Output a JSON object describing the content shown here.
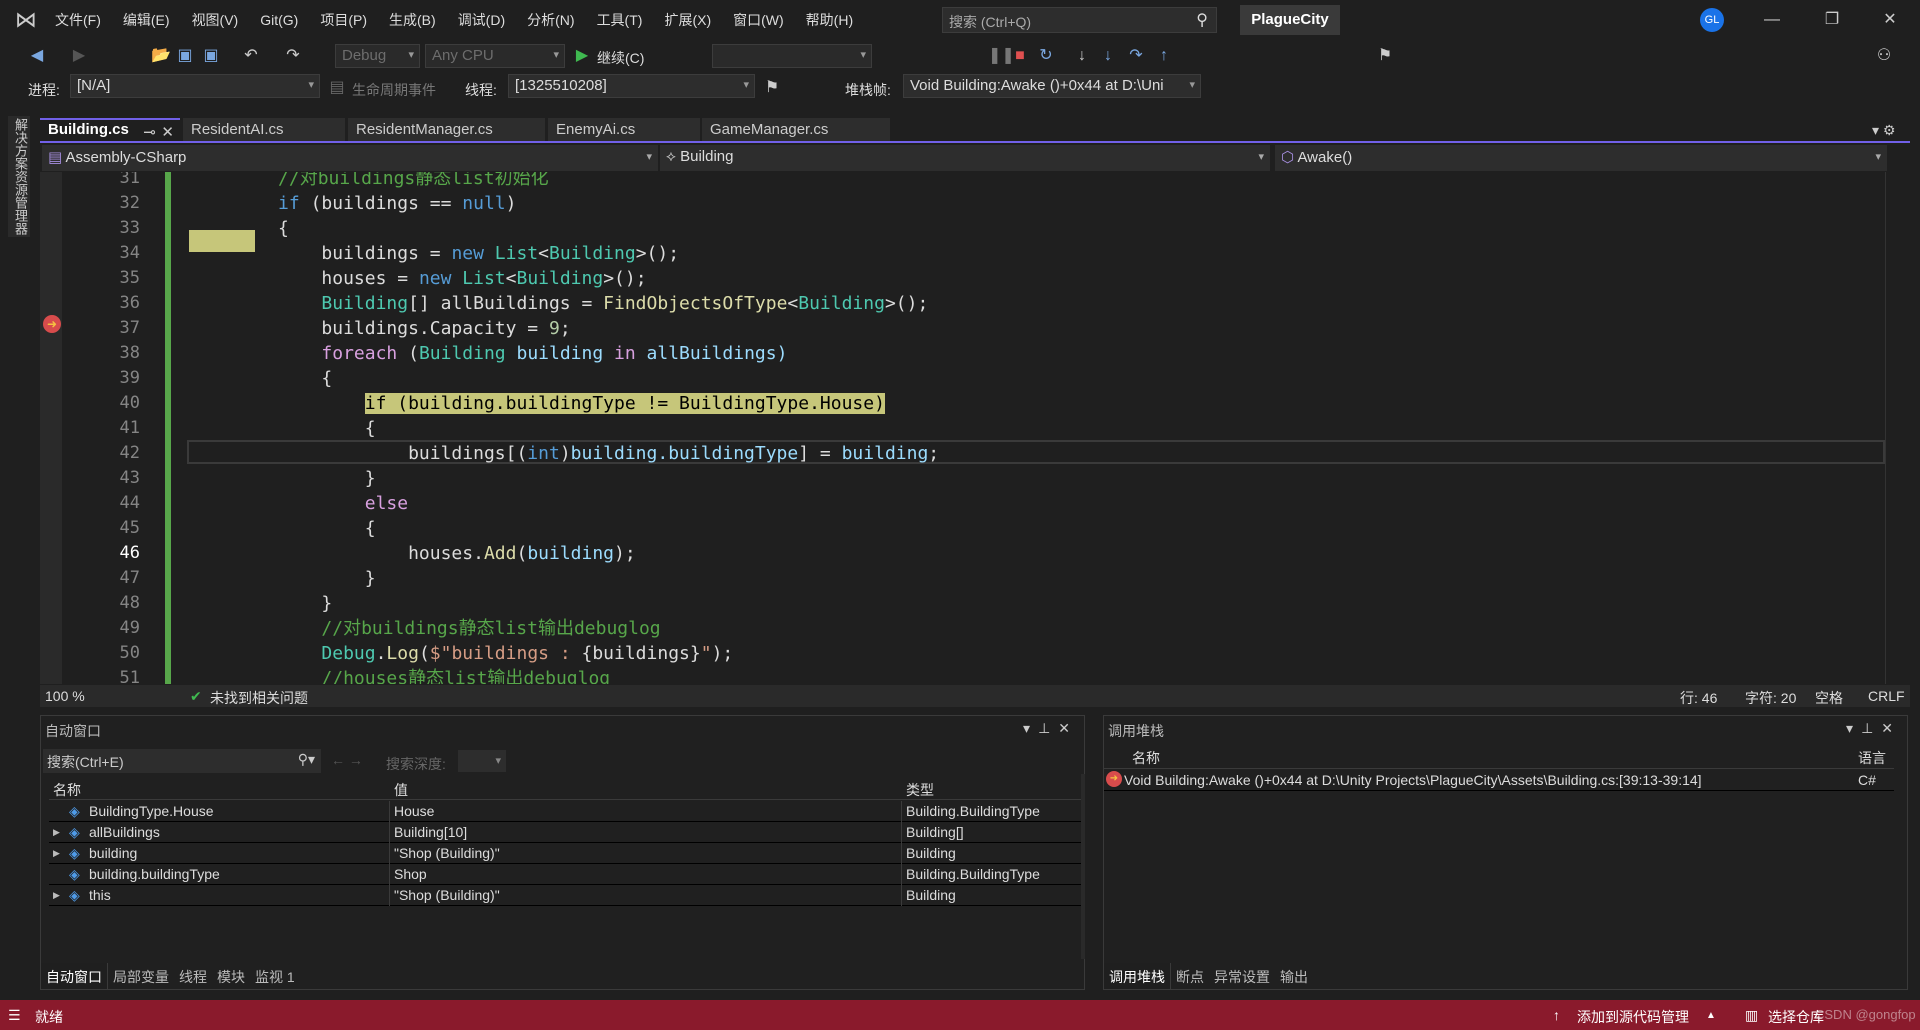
{
  "menubar": {
    "items": [
      "文件(F)",
      "编辑(E)",
      "视图(V)",
      "Git(G)",
      "项目(P)",
      "生成(B)",
      "调试(D)",
      "分析(N)",
      "工具(T)",
      "扩展(X)",
      "窗口(W)",
      "帮助(H)"
    ],
    "search_placeholder": "搜索 (Ctrl+Q)",
    "project": "PlagueCity",
    "avatar": "GL"
  },
  "toolbar": {
    "config": "Debug",
    "platform": "Any CPU",
    "continue": "继续(C)"
  },
  "debugbar": {
    "process_label": "进程:",
    "process": "[N/A]",
    "lifecycle": "生命周期事件",
    "thread_label": "线程:",
    "thread": "[1325510208]",
    "stackframe_label": "堆栈帧:",
    "stackframe": "Void Building:Awake ()+0x44 at D:\\Uni"
  },
  "sidebar": {
    "solution_explorer": "解决方案资源管理器"
  },
  "tabs": [
    {
      "label": "Building.cs",
      "active": true
    },
    {
      "label": "ResidentAI.cs"
    },
    {
      "label": "ResidentManager.cs"
    },
    {
      "label": "EnemyAi.cs"
    },
    {
      "label": "GameManager.cs"
    }
  ],
  "navbar": {
    "project": "Assembly-CSharp",
    "class": "Building",
    "member": "Awake()"
  },
  "code": {
    "current_line": 46,
    "next_statement_line": 40,
    "lines": [
      {
        "n": 31,
        "t": [
          [
            "            //对buildings静态list初始化",
            "cm"
          ]
        ]
      },
      {
        "n": 32,
        "t": [
          [
            "            ",
            "p"
          ],
          [
            "if",
            "k"
          ],
          [
            " (buildings == ",
            "p"
          ],
          [
            "null",
            "k"
          ],
          [
            ")",
            "p"
          ]
        ]
      },
      {
        "n": 33,
        "t": [
          [
            "            {",
            "p"
          ]
        ]
      },
      {
        "n": 34,
        "t": [
          [
            "                buildings = ",
            "p"
          ],
          [
            "new",
            "k"
          ],
          [
            " ",
            "p"
          ],
          [
            "List",
            "t"
          ],
          [
            "<",
            "p"
          ],
          [
            "Building",
            "t"
          ],
          [
            ">();",
            "p"
          ]
        ]
      },
      {
        "n": 35,
        "t": [
          [
            "                houses = ",
            "p"
          ],
          [
            "new",
            "k"
          ],
          [
            " ",
            "p"
          ],
          [
            "List",
            "t"
          ],
          [
            "<",
            "p"
          ],
          [
            "Building",
            "t"
          ],
          [
            ">();",
            "p"
          ]
        ]
      },
      {
        "n": 36,
        "t": [
          [
            "                ",
            "p"
          ],
          [
            "Building",
            "t"
          ],
          [
            "[] allBuildings = ",
            "p"
          ],
          [
            "FindObjectsOfType",
            "m"
          ],
          [
            "<",
            "p"
          ],
          [
            "Building",
            "t"
          ],
          [
            ">();",
            "p"
          ]
        ]
      },
      {
        "n": 37,
        "t": [
          [
            "                buildings.Capacity = ",
            "p"
          ],
          [
            "9",
            "n"
          ],
          [
            ";",
            "p"
          ]
        ]
      },
      {
        "n": 38,
        "t": [
          [
            "                ",
            "p"
          ],
          [
            "foreach",
            "c"
          ],
          [
            " (",
            "p"
          ],
          [
            "Building",
            "t"
          ],
          [
            " building ",
            "v"
          ],
          [
            "in",
            "c"
          ],
          [
            " allBuildings)",
            "v"
          ]
        ]
      },
      {
        "n": 39,
        "t": [
          [
            "                {",
            "p"
          ]
        ]
      },
      {
        "n": 40,
        "hl": "if (building.buildingType != BuildingType.House)",
        "t": [
          [
            "                    ",
            "p"
          ]
        ]
      },
      {
        "n": 41,
        "t": [
          [
            "                    {",
            "p"
          ]
        ]
      },
      {
        "n": 42,
        "t": [
          [
            "                        buildings[(",
            "p"
          ],
          [
            "int",
            "k"
          ],
          [
            ")",
            "p"
          ],
          [
            "building.buildingType",
            "v"
          ],
          [
            "] = ",
            "p"
          ],
          [
            "building",
            "v"
          ],
          [
            ";",
            "p"
          ]
        ]
      },
      {
        "n": 43,
        "t": [
          [
            "                    }",
            "p"
          ]
        ]
      },
      {
        "n": 44,
        "t": [
          [
            "                    ",
            "p"
          ],
          [
            "else",
            "c"
          ]
        ]
      },
      {
        "n": 45,
        "t": [
          [
            "                    {",
            "p"
          ]
        ]
      },
      {
        "n": 46,
        "t": [
          [
            "                        houses.",
            "p"
          ],
          [
            "Add",
            "m"
          ],
          [
            "(",
            "p"
          ],
          [
            "building",
            "v"
          ],
          [
            ");",
            "p"
          ]
        ]
      },
      {
        "n": 47,
        "t": [
          [
            "                    }",
            "p"
          ]
        ]
      },
      {
        "n": 48,
        "t": [
          [
            "                }",
            "p"
          ]
        ]
      },
      {
        "n": 49,
        "t": [
          [
            "                //对buildings静态list输出debuglog",
            "cm"
          ]
        ]
      },
      {
        "n": 50,
        "t": [
          [
            "                ",
            "p"
          ],
          [
            "Debug",
            "t"
          ],
          [
            ".",
            "p"
          ],
          [
            "Log",
            "m"
          ],
          [
            "(",
            "p"
          ],
          [
            "$\"buildings : ",
            "s"
          ],
          [
            "{buildings}",
            "p"
          ],
          [
            "\"",
            "s"
          ],
          [
            ");",
            "p"
          ]
        ]
      },
      {
        "n": 51,
        "t": [
          [
            "                //houses静态list输出debuglog",
            "cm"
          ]
        ]
      }
    ]
  },
  "editor_status": {
    "zoom": "100 %",
    "issues": "未找到相关问题",
    "line": "行: 46",
    "char": "字符: 20",
    "spaces": "空格",
    "eol": "CRLF"
  },
  "autos": {
    "title": "自动窗口",
    "search_placeholder": "搜索(Ctrl+E)",
    "depth_label": "搜索深度:",
    "columns": [
      "名称",
      "值",
      "类型"
    ],
    "rows": [
      {
        "name": "BuildingType.House",
        "value": "House",
        "type": "Building.BuildingType",
        "expandable": false
      },
      {
        "name": "allBuildings",
        "value": "Building[10]",
        "type": "Building[]",
        "expandable": true
      },
      {
        "name": "building",
        "value": "\"Shop (Building)\"",
        "type": "Building",
        "expandable": true
      },
      {
        "name": "building.buildingType",
        "value": "Shop",
        "type": "Building.BuildingType",
        "expandable": false
      },
      {
        "name": "this",
        "value": "\"Shop (Building)\"",
        "type": "Building",
        "expandable": true
      }
    ],
    "tabs": [
      "自动窗口",
      "局部变量",
      "线程",
      "模块",
      "监视 1"
    ]
  },
  "callstack": {
    "title": "调用堆栈",
    "columns": [
      "名称",
      "语言"
    ],
    "rows": [
      {
        "name": "Void Building:Awake ()+0x44 at D:\\Unity Projects\\PlagueCity\\Assets\\Building.cs:[39:13-39:14]",
        "lang": "C#"
      }
    ],
    "tabs": [
      "调用堆栈",
      "断点",
      "异常设置",
      "输出"
    ]
  },
  "statusbar": {
    "ready": "就绪",
    "source_control": "添加到源代码管理",
    "repo": "选择仓库",
    "watermark": "CSDN @gongfop",
    "color": "#8a1a2c"
  }
}
